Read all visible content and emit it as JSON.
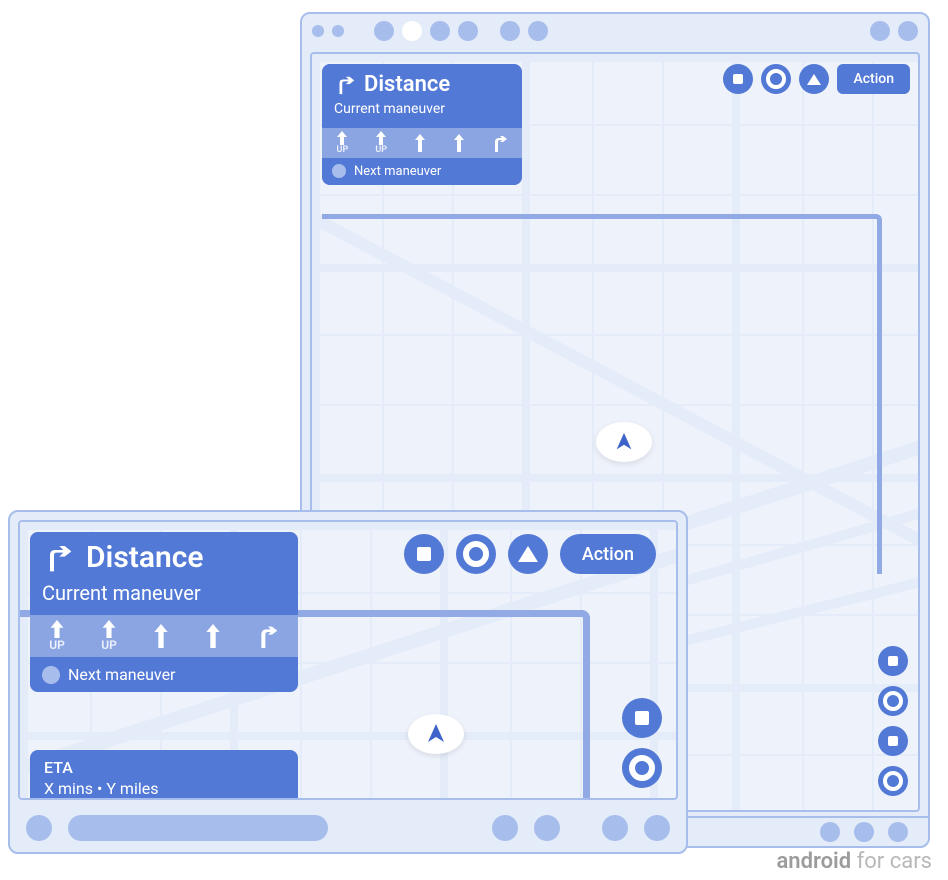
{
  "card": {
    "distance_label": "Distance",
    "current_maneuver_label": "Current maneuver",
    "next_maneuver_label": "Next maneuver",
    "lanes": [
      {
        "arrow": "up",
        "label": "UP"
      },
      {
        "arrow": "up",
        "label": "UP"
      },
      {
        "arrow": "up",
        "label": ""
      },
      {
        "arrow": "up",
        "label": ""
      },
      {
        "arrow": "right",
        "label": ""
      }
    ]
  },
  "eta": {
    "title": "ETA",
    "detail": "X mins • Y miles"
  },
  "actions": {
    "primary_label": "Action"
  },
  "watermark": {
    "bold": "android",
    "rest": " for cars"
  }
}
